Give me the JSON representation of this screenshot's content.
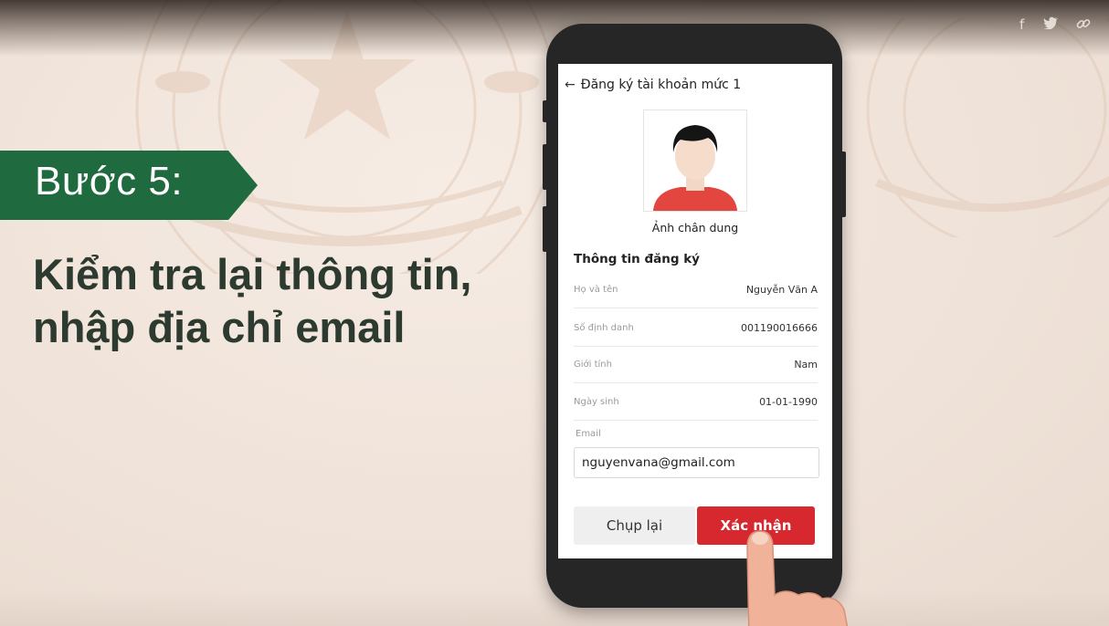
{
  "share_icons": [
    {
      "name": "facebook-icon",
      "glyph": "f"
    },
    {
      "name": "twitter-icon",
      "glyph": "🐦"
    },
    {
      "name": "link-icon",
      "glyph": "🔗"
    }
  ],
  "step": {
    "label": "Bước 5:",
    "banner_color": "#1f6b3f"
  },
  "headline": {
    "line1": "Kiểm tra lại thông tin,",
    "line2": "nhập địa chỉ email"
  },
  "app": {
    "header": {
      "back_icon": "arrow-left-icon",
      "title": "Đăng ký tài khoản mức 1"
    },
    "portrait_caption": "Ảnh chân dung",
    "section_title": "Thông tin đăng ký",
    "fields": [
      {
        "label": "Họ và tên",
        "value": "Nguyễn Văn A"
      },
      {
        "label": "Số định danh",
        "value": "001190016666"
      },
      {
        "label": "Giới tính",
        "value": "Nam"
      },
      {
        "label": "Ngày sinh",
        "value": "01-01-1990"
      }
    ],
    "email": {
      "label": "Email",
      "value": "nguyenvana@gmail.com"
    },
    "buttons": {
      "retake": "Chụp lại",
      "confirm": "Xác nhận"
    },
    "accent_color": "#d7282f"
  }
}
